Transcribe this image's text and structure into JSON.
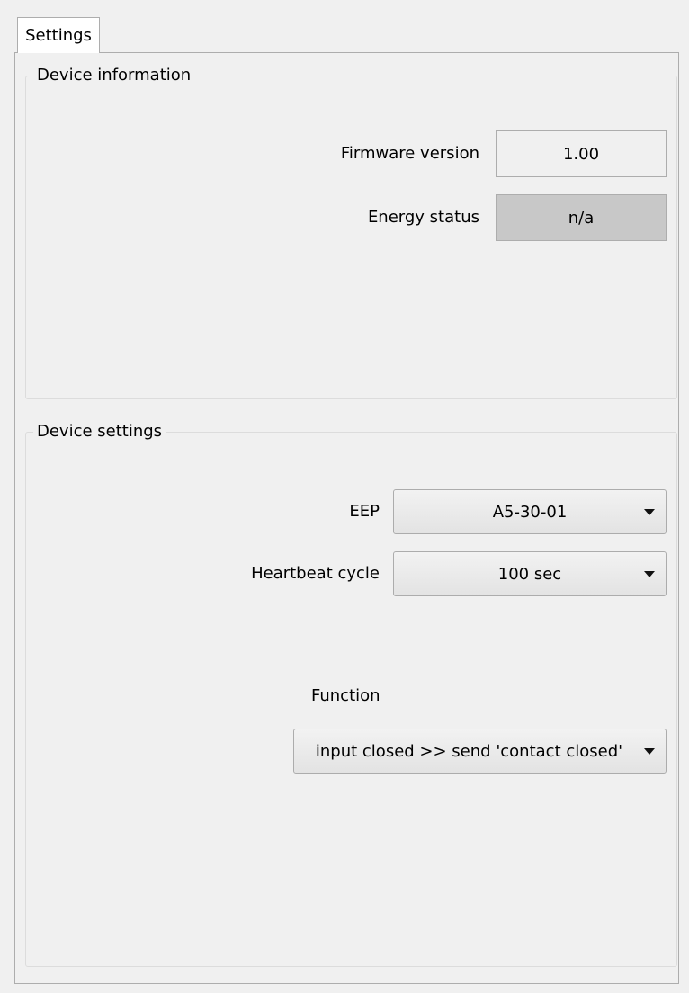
{
  "tab": {
    "label": "Settings"
  },
  "device_information": {
    "title": "Device information",
    "firmware_label": "Firmware version",
    "firmware_value": "1.00",
    "energy_label": "Energy status",
    "energy_value": "n/a"
  },
  "device_settings": {
    "title": "Device settings",
    "eep_label": "EEP",
    "eep_value": "A5-30-01",
    "heartbeat_label": "Heartbeat cycle",
    "heartbeat_value": "100 sec",
    "function_label": "Function",
    "function_value": "input closed >> send 'contact closed'"
  },
  "icons": {
    "dropdown": "chevron-down-icon"
  }
}
